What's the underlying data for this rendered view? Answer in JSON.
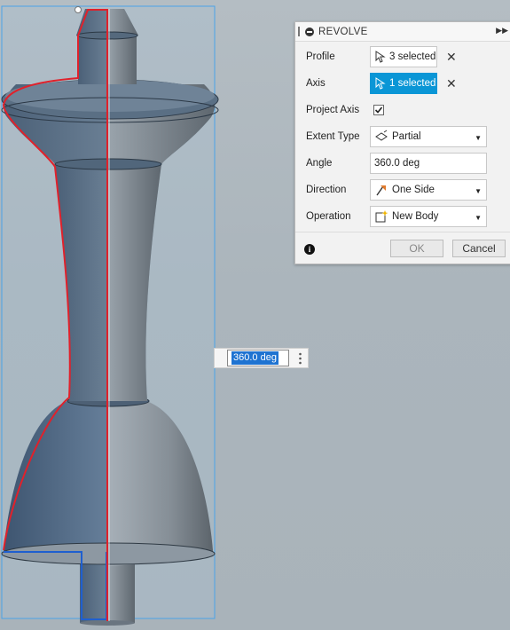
{
  "dialog": {
    "title": "REVOLVE",
    "rows": {
      "profile": {
        "label": "Profile",
        "value": "3 selected"
      },
      "axis": {
        "label": "Axis",
        "value": "1 selected"
      },
      "project_axis": {
        "label": "Project Axis",
        "checked": true
      },
      "extent_type": {
        "label": "Extent Type",
        "value": "Partial",
        "icon": "partial-extent-icon"
      },
      "angle": {
        "label": "Angle",
        "value": "360.0 deg"
      },
      "direction": {
        "label": "Direction",
        "value": "One Side",
        "icon": "one-side-icon"
      },
      "operation": {
        "label": "Operation",
        "value": "New Body",
        "icon": "new-body-icon"
      }
    },
    "buttons": {
      "ok": "OK",
      "cancel": "Cancel"
    }
  },
  "canvas_input": {
    "value": "360.0 deg"
  },
  "colors": {
    "accent": "#0a96d6",
    "profile_highlight": "#e0212b",
    "selection_box": "#4aa3e8",
    "model_body": "#5b6f82"
  }
}
